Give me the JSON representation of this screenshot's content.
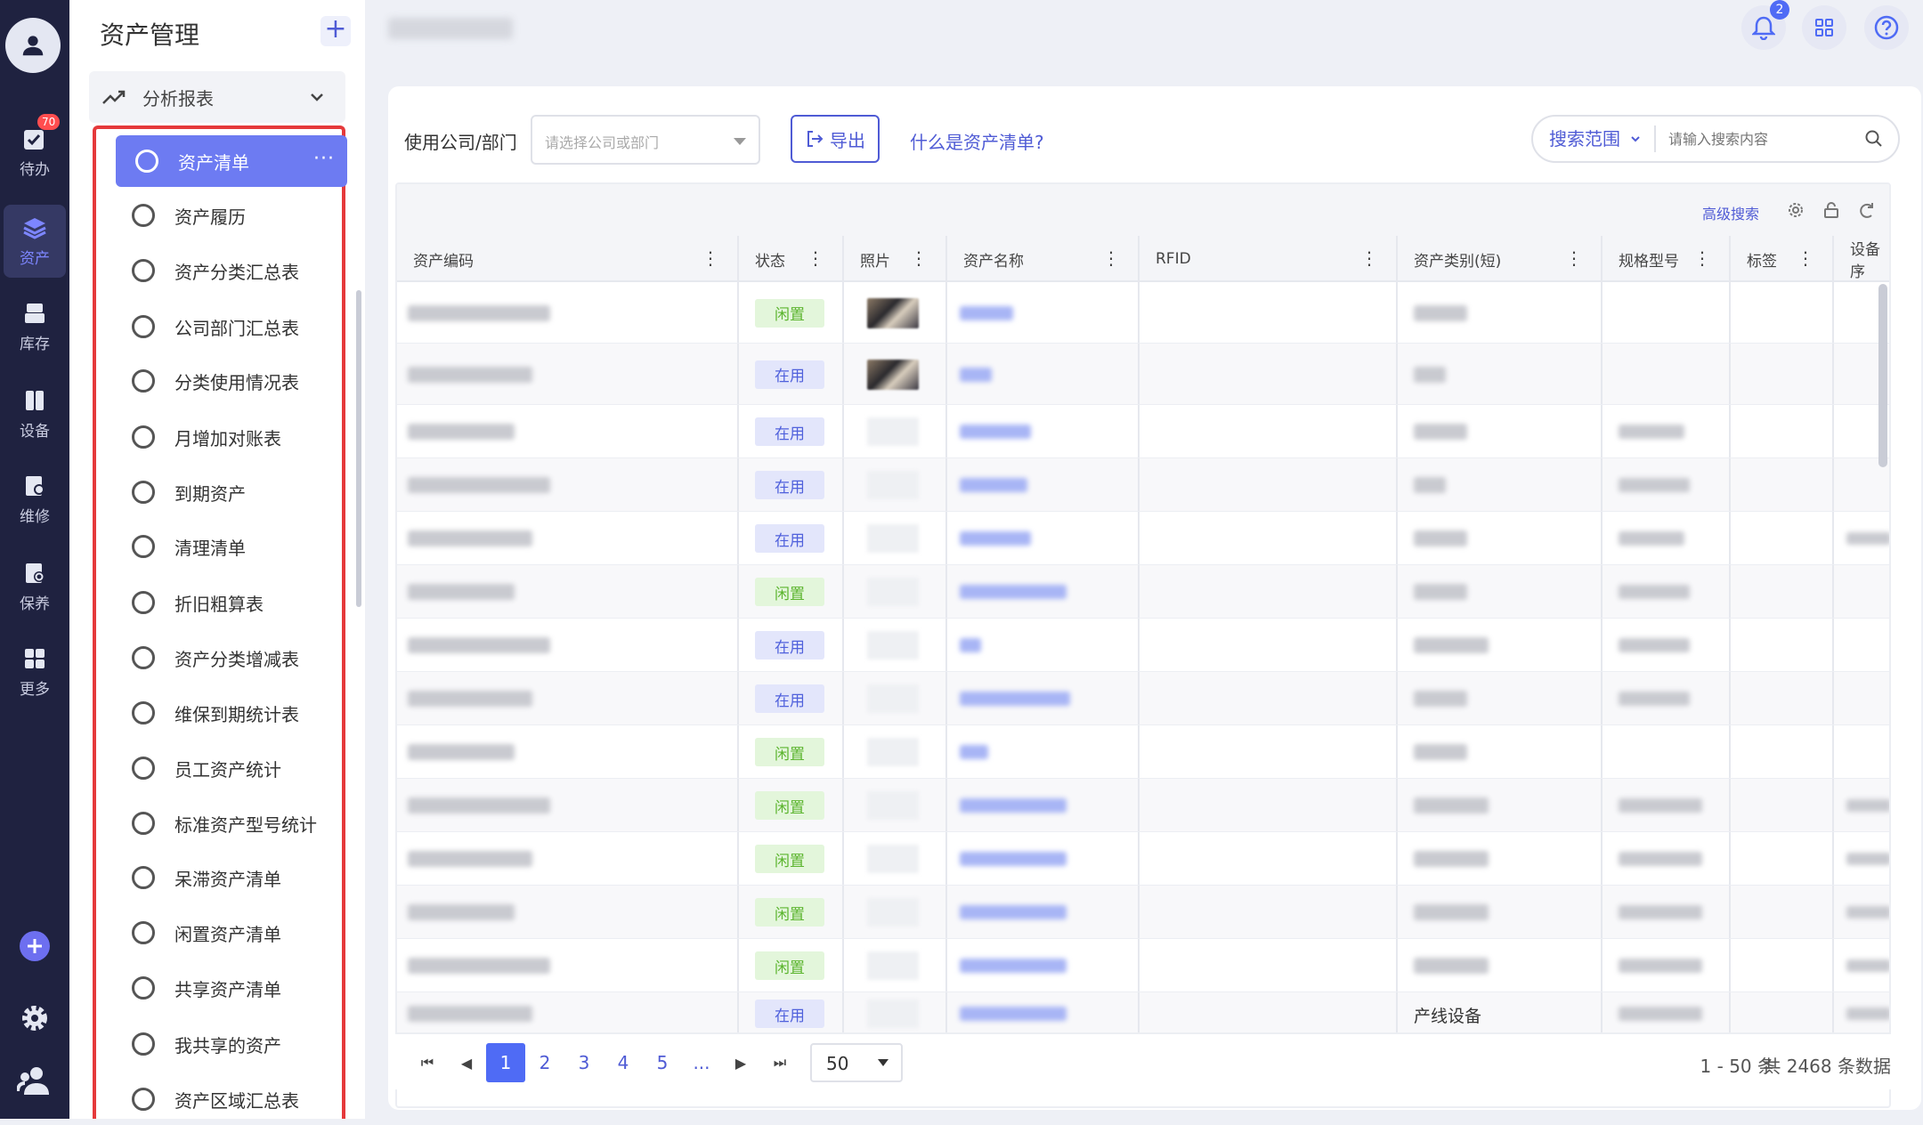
{
  "leftnav": {
    "items": [
      {
        "label": "待办",
        "icon": "todo-icon",
        "badge": "70"
      },
      {
        "label": "资产",
        "icon": "layers-icon"
      },
      {
        "label": "库存",
        "icon": "inventory-icon"
      },
      {
        "label": "设备",
        "icon": "device-icon"
      },
      {
        "label": "维修",
        "icon": "repair-icon"
      },
      {
        "label": "保养",
        "icon": "maintenance-icon"
      },
      {
        "label": "更多",
        "icon": "more-apps-icon"
      }
    ],
    "active_color": "#7d86ff"
  },
  "sidebar": {
    "title": "资产管理",
    "add_label": "+",
    "group_label": "分析报表",
    "items": [
      "资产清单",
      "资产履历",
      "资产分类汇总表",
      "公司部门汇总表",
      "分类使用情况表",
      "月增加对账表",
      "到期资产",
      "清理清单",
      "折旧粗算表",
      "资产分类增减表",
      "维保到期统计表",
      "员工资产统计",
      "标准资产型号统计",
      "呆滞资产清单",
      "闲置资产清单",
      "共享资产清单",
      "我共享的资产",
      "资产区域汇总表"
    ],
    "active_index": 0,
    "more_label": "···"
  },
  "topbar": {
    "notification_count": "2"
  },
  "filter": {
    "label": "使用公司/部门",
    "placeholder": "请选择公司或部门",
    "export_label": "导出",
    "help_link": "什么是资产清单?"
  },
  "search": {
    "scope_label": "搜索范围",
    "placeholder": "请输入搜索内容",
    "advanced_label": "高级搜索"
  },
  "table": {
    "columns": [
      "资产编码",
      "状态",
      "照片",
      "资产名称",
      "RFID",
      "资产类别(短)",
      "规格型号",
      "标签",
      "设备序"
    ],
    "rows": [
      {
        "status": "闲置",
        "photo": true
      },
      {
        "status": "在用",
        "photo": true
      },
      {
        "status": "在用",
        "photo": false
      },
      {
        "status": "在用",
        "photo": false
      },
      {
        "status": "在用",
        "photo": false
      },
      {
        "status": "闲置",
        "photo": false
      },
      {
        "status": "在用",
        "photo": false
      },
      {
        "status": "在用",
        "photo": false
      },
      {
        "status": "闲置",
        "photo": false
      },
      {
        "status": "闲置",
        "photo": false
      },
      {
        "status": "闲置",
        "photo": false
      },
      {
        "status": "闲置",
        "photo": false
      },
      {
        "status": "闲置",
        "photo": false
      },
      {
        "status": "在用",
        "photo": false
      }
    ],
    "last_row_category": "产线设备",
    "idle_color": "#5cb52f",
    "inuse_color": "#5061dc"
  },
  "pagination": {
    "pages": [
      "1",
      "2",
      "3",
      "4",
      "5",
      "..."
    ],
    "current": "1",
    "page_size": "50",
    "range_text": "1 - 50 条",
    "total_text": "共 2468 条数据"
  },
  "colors": {
    "accent": "#4f5bd5",
    "sidebar_dark": "#1f2240",
    "highlight_border": "#e5393b"
  }
}
